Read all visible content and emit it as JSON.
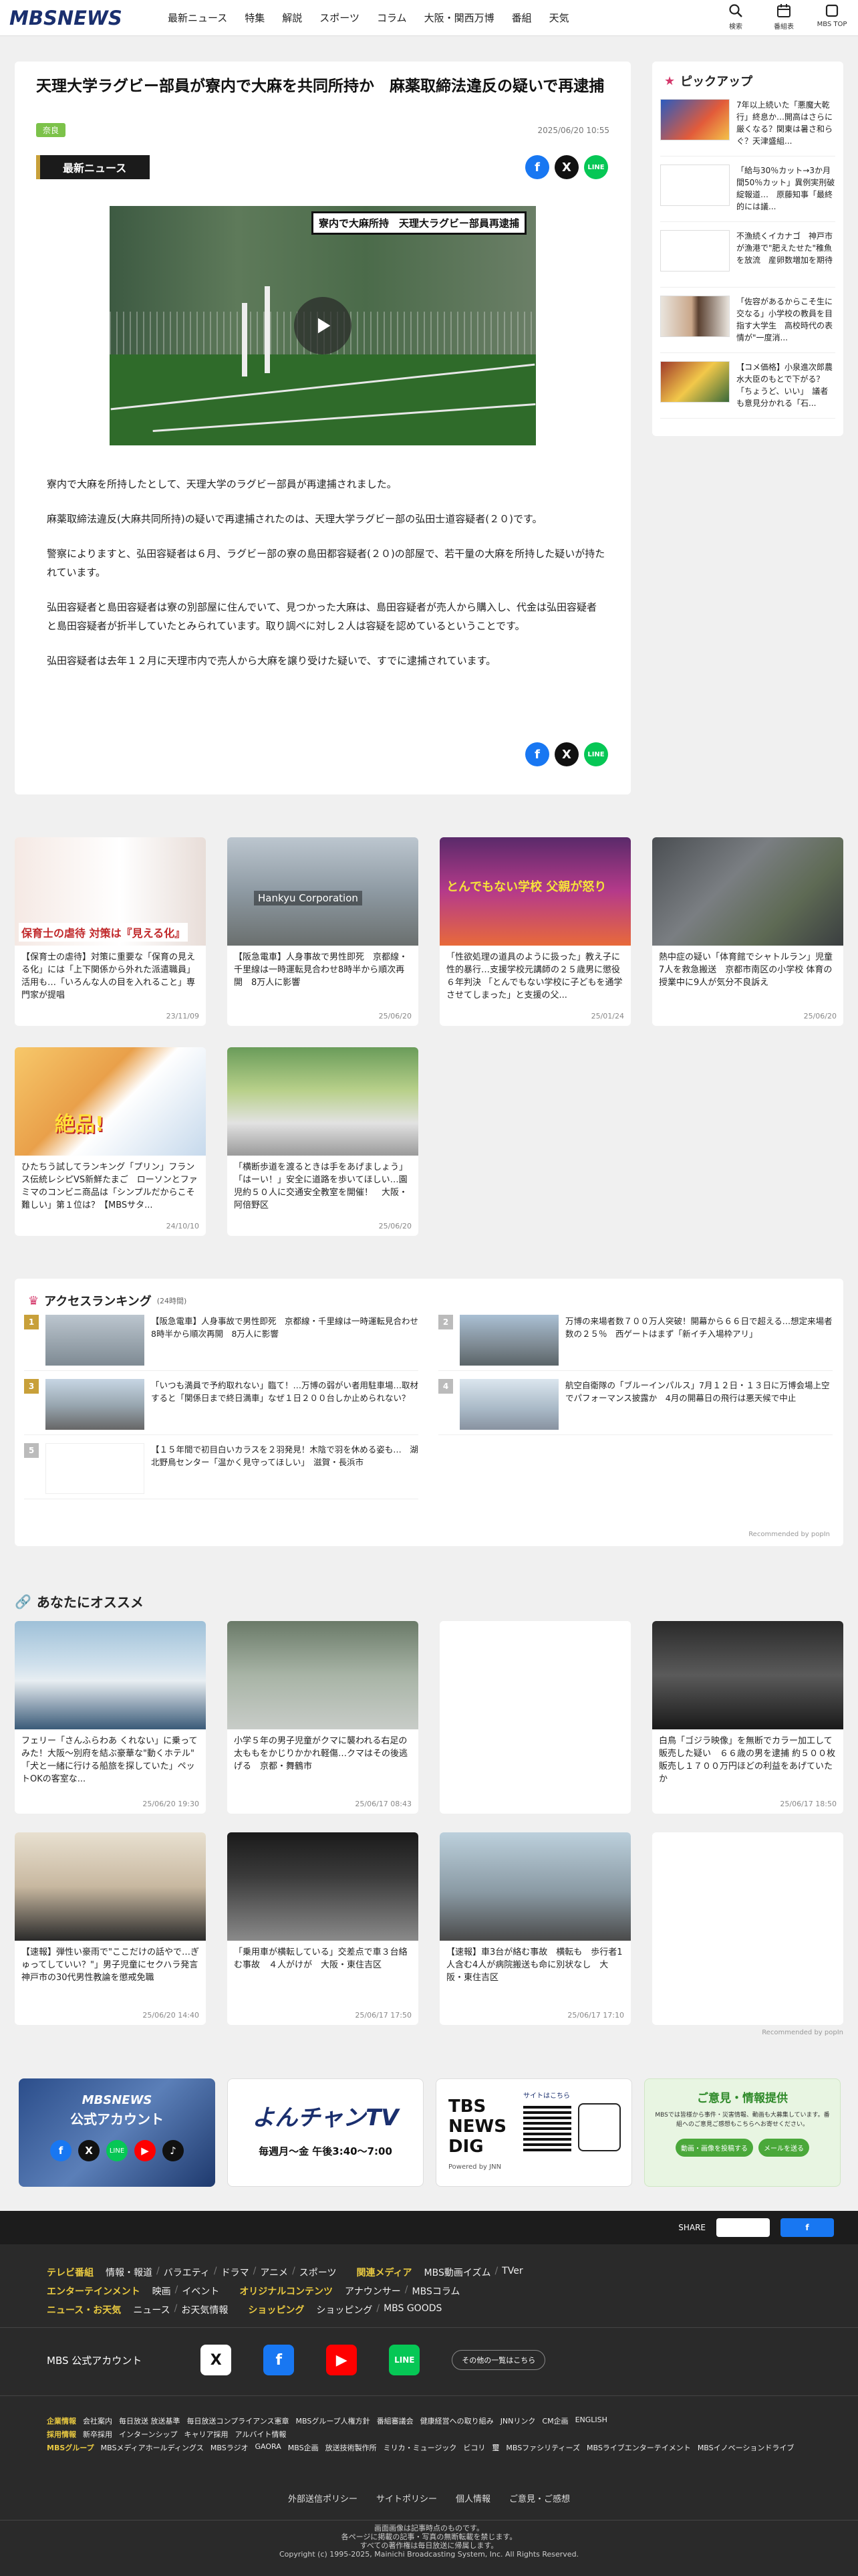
{
  "header": {
    "logo": "MBSNEWS",
    "nav": [
      "最新ニュース",
      "特集",
      "解説",
      "スポーツ",
      "コラム",
      "大阪・関西万博",
      "番組",
      "天気"
    ],
    "icons": [
      {
        "label": "検索",
        "icon": "search-icon"
      },
      {
        "label": "番組表",
        "icon": "calendar-icon"
      },
      {
        "label": "MBS TOP",
        "icon": "square-icon"
      }
    ]
  },
  "article": {
    "title": "天理大学ラグビー部員が寮内で大麻を共同所持か　麻薬取締法違反の疑いで再逮捕",
    "tag": "奈良",
    "date": "2025/06/20 10:55",
    "badge": "最新ニュース",
    "video_caption": "寮内で大麻所持　天理大ラグビー部員再逮捕",
    "paragraphs": [
      "寮内で大麻を所持したとして、天理大学のラグビー部員が再逮捕されました。",
      "麻薬取締法違反(大麻共同所持)の疑いで再逮捕されたのは、天理大学ラグビー部の弘田士道容疑者(２０)です。",
      "警察によりますと、弘田容疑者は６月、ラグビー部の寮の島田都容疑者(２０)の部屋で、若干量の大麻を所持した疑いが持たれています。",
      "弘田容疑者と島田容疑者は寮の別部屋に住んでいて、見つかった大麻は、島田容疑者が売人から購入し、代金は弘田容疑者と島田容疑者が折半していたとみられています。取り調べに対し２人は容疑を認めているということです。",
      "弘田容疑者は去年１２月に天理市内で売人から大麻を譲り受けた疑いで、すでに逮捕されています。"
    ]
  },
  "pickup": {
    "title": "ピックアップ",
    "items": [
      "7年以上続いた「悪魔大乾行」終息か…開高はさらに厳くなる？関東は暑さ和らぐ？天津盛組...",
      "「給与30％カット→3か月間50％カット」異例実刑破綻報道…　原藤知事「最終的には議...",
      "不漁続くイカナゴ　神戸市が漁港で\"肥えたせた\"稚魚を放流　産卵数増加を期待",
      "「佐容があるからこそ生に交なる」小学校の教員を目指す大学生　高校時代の表情が\"一度消...",
      "【コメ価格】小泉進次郎農水大臣のもとで下がる？「ちょうど、いい」　議者も意見分かれる「石..."
    ]
  },
  "related": [
    {
      "text": "【保育士の虐待】対策に重要な「保育の見える化」には「上下関係から外れた派遣職員」活用も…「いろんな人の目を入れること」専門家が提唱",
      "date": "23/11/09",
      "img_label": "保育士の虐待 対策は『見える化』"
    },
    {
      "text": "【阪急電車】人身事故で男性即死　京都線・千里線は一時運転見合わせ8時半から順次再開　8万人に影響",
      "date": "25/06/20",
      "img_label": "Hankyu Corporation"
    },
    {
      "text": "「性欲処理の道具のように扱った」教え子に性的暴行…支援学校元講師の２５歳男に懲役６年判決 「とんでもない学校に子どもを通学させてしまった」と支援の父...",
      "date": "25/01/24",
      "img_label": "とんでもない学校 父親が怒り"
    },
    {
      "text": "熱中症の疑い「体育館でシャトルラン」児童7人を救急搬送　京都市南区の小学校 体育の授業中に9人が気分不良訴え",
      "date": "25/06/20",
      "img_label": ""
    },
    {
      "text": "ひたちう試してランキング「プリン」フランス伝統レシピVS新鮮たまご　ローソンとファミマのコンビニ商品は「シンプルだからこそ難しい」第１位は？【MBSサタ...",
      "date": "24/10/10",
      "img_label": "絶品!"
    },
    {
      "text": "「横断歩道を渡るときは手をあげましょう」「はーい！」安全に道路を歩いてほしい…園児約５０人に交通安全教室を開催！　大阪・阿倍野区",
      "date": "25/06/20",
      "img_label": ""
    }
  ],
  "ranking": {
    "title": "アクセスランキング",
    "subtitle": "(24時間)",
    "items": [
      {
        "rank": "1",
        "text": "【阪急電車】人身事故で男性即死　京都線・千里線は一時運転見合わせ8時半から順次再開　8万人に影響"
      },
      {
        "rank": "2",
        "text": "万博の来場者数７００万人突破！開幕から６６日で超える…想定来場者数の２５％　西ゲートはまず「新イチ入場枠アリ」"
      },
      {
        "rank": "3",
        "text": "「いつも満員で予約取れない」臨て！…万博の弱がい者用駐車場…取材すると「関係日まで終日満車」なぜ１日２００台しか止められない？"
      },
      {
        "rank": "4",
        "text": "航空自衛隊の「ブルーインパルス」7月１２日・１３日に万博会場上空でパフォーマンス披露か　4月の開幕日の飛行は悪天候で中止"
      },
      {
        "rank": "5",
        "text": "【１５年間で初目白いカラスを２羽発見！木陰で羽を休める姿も…　湖北野鳥センター「温かく見守ってほしい」　滋賀・長浜市"
      }
    ],
    "footer": "Recommended by popIn"
  },
  "recommend": {
    "title": "あなたにオススメ",
    "items": [
      {
        "text": "フェリー「さんふらわあ くれない」に乗ってみた！大阪～別府を結ぶ豪華な\"動くホテル\"　「犬と一緒に行ける船旅を探していた」ペットOKの客室な...",
        "date": "25/06/20 19:30"
      },
      {
        "text": "小学５年の男子児童がクマに襲われる右足の太ももをかじりかかれ軽傷…クマはその後逃げる　京都・舞鶴市",
        "date": "25/06/17 08:43"
      },
      {
        "text": "",
        "date": ""
      },
      {
        "text": "白鳥「ゴジラ映像」を無断でカラー加工して販売した疑い　６６歳の男を逮捕 約５００枚販売し１７００万円ほどの利益をあげていたか",
        "date": "25/06/17 18:50"
      },
      {
        "text": "【速報】弾性い豪雨で\"ここだけの話やで…ぎゅってしていい？\"」男子児童にセクハラ発言　神戸市の30代男性教論を懲戒免職",
        "date": "25/06/20 14:40"
      },
      {
        "text": "「乗用車が横転している」交差点で車３台絡む事故　４人がけが　大阪・東住吉区",
        "date": "25/06/17 17:50"
      },
      {
        "text": "【速報】車3台が絡む事故　横転も　歩行者1人含む4人が病院搬送も命に別状なし　大阪・東住吉区",
        "date": "25/06/17 17:10"
      },
      {
        "text": "",
        "date": ""
      }
    ],
    "footer": "Recommended by popIn"
  },
  "banners": {
    "official": {
      "line1": "MBSNEWS",
      "line2": "公式アカウント"
    },
    "yon": {
      "title": "よんチャンTV",
      "sub": "毎週月～金 午後3:40～7:00"
    },
    "tbs": {
      "title": "TBS NEWS DIG",
      "sub": "Powered by JNN",
      "note": "サイトはこちら"
    },
    "opinion": {
      "title": "ご意見・情報提供",
      "desc": "MBSでは皆様から事件・災害情報、動画も大募集しています。番組へのご意見ご感想もこちらへお寄せください。",
      "btn1": "動画・画像を投稿する",
      "btn2": "メールを送る"
    }
  },
  "footer": {
    "share_label": "SHARE",
    "rows": [
      {
        "cat": "テレビ番組",
        "items": [
          "情報・報道",
          "バラエティ",
          "ドラマ",
          "アニメ",
          "スポーツ"
        ],
        "cat2": "関連メディア",
        "items2": [
          "MBS動画イズム",
          "TVer"
        ]
      },
      {
        "cat": "エンターテインメント",
        "items": [
          "映画",
          "イベント"
        ],
        "cat2": "オリジナルコンテンツ",
        "items2": [
          "アナウンサー",
          "MBSコラム"
        ]
      },
      {
        "cat": "ニュース・お天気",
        "items": [
          "ニュース",
          "お天気情報"
        ],
        "cat2": "ショッピング",
        "items2": [
          "ショッピング",
          "MBS GOODS"
        ]
      }
    ],
    "accounts_label": "MBS 公式アカウント",
    "accounts_btn": "その他の一覧はこちら",
    "corp": {
      "cat": "企業情報",
      "items": [
        "会社案内",
        "毎日放送 放送基準",
        "毎日放送コンプライアンス憲章",
        "MBSグループ人権方針",
        "番組審議会",
        "健康経営への取り組み",
        "JNNリンク",
        "CM企画",
        "ENGLISH"
      ]
    },
    "recruit": {
      "cat": "採用情報",
      "items": [
        "新卒採用",
        "インターンシップ",
        "キャリア採用",
        "アルバイト情報"
      ]
    },
    "group": {
      "cat": "MBSグループ",
      "items": [
        "MBSメディアホールディングス",
        "MBSラジオ",
        "GAORA",
        "MBS企画",
        "放送技術製作所",
        "ミリカ・ミュージック",
        "ビコリ",
        "璽",
        "MBSファシリティーズ",
        "MBSライブエンターテイメント",
        "MBSイノベーションドライブ"
      ]
    },
    "links": [
      "外部送信ポリシー",
      "サイトポリシー",
      "個人情報",
      "ご意見・ご感想"
    ],
    "copy1": "画面画像は記事時点のものです。",
    "copy2": "各ページに掲載の記事・写真の無断転載を禁じます。",
    "copy3": "すべての著作権は毎日放送に帰属します。",
    "copy4": "Copyright (c) 1995-2025, Mainichi Broadcasting System, Inc. All Rights Reserved."
  }
}
